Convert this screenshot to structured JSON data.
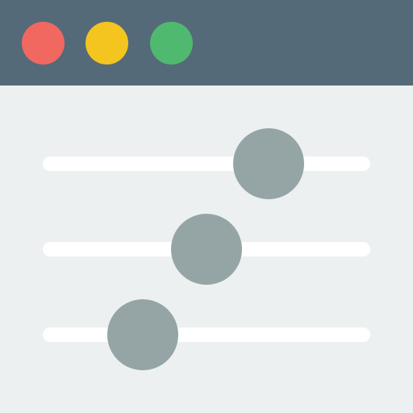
{
  "colors": {
    "titlebar": "#546A79",
    "window_background": "#ECF0F1",
    "track": "#FFFFFF",
    "thumb": "#95A5A5"
  },
  "window_controls": [
    {
      "name": "close-button",
      "color": "#F0685F"
    },
    {
      "name": "minimize-button",
      "color": "#F3C51E"
    },
    {
      "name": "maximize-button",
      "color": "#4FBA6F"
    }
  ],
  "sliders": [
    {
      "name": "slider-1",
      "value": 0.69
    },
    {
      "name": "slider-2",
      "value": 0.5
    },
    {
      "name": "slider-3",
      "value": 0.305
    }
  ]
}
